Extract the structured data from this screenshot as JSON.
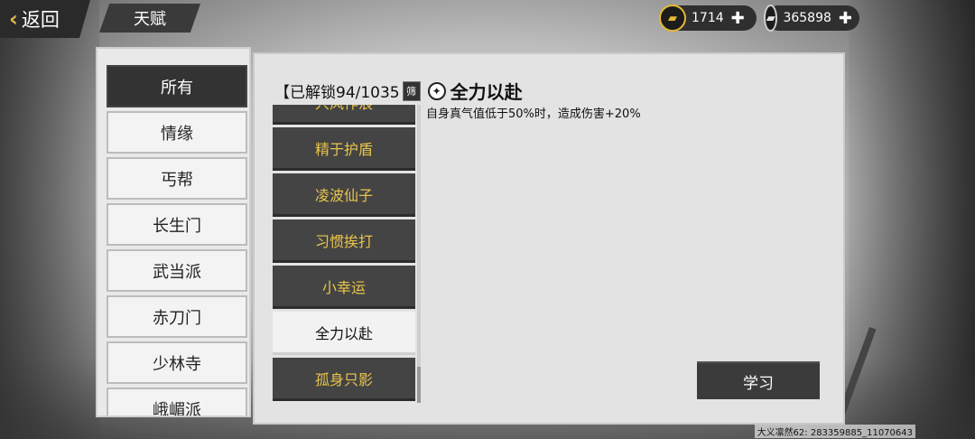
{
  "header": {
    "back_label": "返回",
    "page_title": "天赋"
  },
  "currency": {
    "gold": {
      "value": "1714",
      "icon": "gold-ingot-icon"
    },
    "silver": {
      "value": "365898",
      "icon": "silver-ingot-icon"
    }
  },
  "categories": [
    "所有",
    "情缘",
    "丐帮",
    "长生门",
    "武当派",
    "赤刀门",
    "少林寺",
    "峨嵋派"
  ],
  "selected_category": "所有",
  "main": {
    "unlocked_text": "【已解锁94/1035",
    "filter_label": "筛",
    "selected_skill_name": "全力以赴",
    "selected_skill_desc": "自身真气值低于50%时，造成伤害+20%",
    "learn_label": "学习"
  },
  "talents": [
    "兴风作浪",
    "精于护盾",
    "凌波仙子",
    "习惯挨打",
    "小幸运",
    "全力以赴",
    "孤身只影"
  ],
  "selected_talent": "全力以赴",
  "footer": {
    "player_info": "大义凛然62: 283359885_11070643"
  },
  "colors": {
    "accent_gold": "#e9c44a",
    "panel_bg": "#e3e3e3",
    "dark_button": "#3b3b3b"
  }
}
